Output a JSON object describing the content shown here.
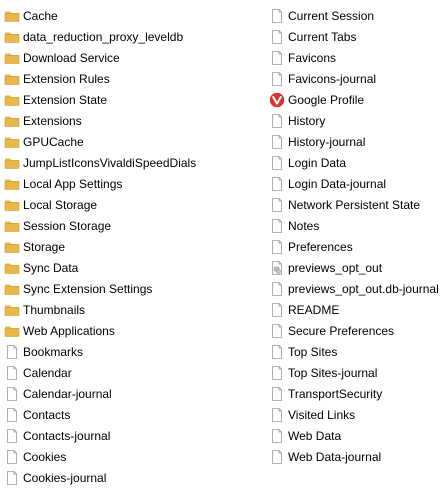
{
  "files": {
    "left": [
      {
        "name": "Cache",
        "icon": "folder-icon"
      },
      {
        "name": "data_reduction_proxy_leveldb",
        "icon": "folder-icon"
      },
      {
        "name": "Download Service",
        "icon": "folder-icon"
      },
      {
        "name": "Extension Rules",
        "icon": "folder-icon"
      },
      {
        "name": "Extension State",
        "icon": "folder-icon"
      },
      {
        "name": "Extensions",
        "icon": "folder-icon"
      },
      {
        "name": "GPUCache",
        "icon": "folder-icon"
      },
      {
        "name": "JumpListIconsVivaldiSpeedDials",
        "icon": "folder-icon"
      },
      {
        "name": "Local App Settings",
        "icon": "folder-icon"
      },
      {
        "name": "Local Storage",
        "icon": "folder-icon"
      },
      {
        "name": "Session Storage",
        "icon": "folder-icon"
      },
      {
        "name": "Storage",
        "icon": "folder-icon"
      },
      {
        "name": "Sync Data",
        "icon": "folder-icon"
      },
      {
        "name": "Sync Extension Settings",
        "icon": "folder-icon"
      },
      {
        "name": "Thumbnails",
        "icon": "folder-icon"
      },
      {
        "name": "Web Applications",
        "icon": "folder-icon"
      },
      {
        "name": "Bookmarks",
        "icon": "file-icon"
      },
      {
        "name": "Calendar",
        "icon": "file-icon"
      },
      {
        "name": "Calendar-journal",
        "icon": "file-icon"
      },
      {
        "name": "Contacts",
        "icon": "file-icon"
      },
      {
        "name": "Contacts-journal",
        "icon": "file-icon"
      },
      {
        "name": "Cookies",
        "icon": "file-icon"
      },
      {
        "name": "Cookies-journal",
        "icon": "file-icon"
      }
    ],
    "right": [
      {
        "name": "Current Session",
        "icon": "file-icon"
      },
      {
        "name": "Current Tabs",
        "icon": "file-icon"
      },
      {
        "name": "Favicons",
        "icon": "file-icon"
      },
      {
        "name": "Favicons-journal",
        "icon": "file-icon"
      },
      {
        "name": "Google Profile",
        "icon": "vivaldi-icon"
      },
      {
        "name": "History",
        "icon": "file-icon"
      },
      {
        "name": "History-journal",
        "icon": "file-icon"
      },
      {
        "name": "Login Data",
        "icon": "file-icon"
      },
      {
        "name": "Login Data-journal",
        "icon": "file-icon"
      },
      {
        "name": "Network Persistent State",
        "icon": "file-icon"
      },
      {
        "name": "Notes",
        "icon": "file-icon"
      },
      {
        "name": "Preferences",
        "icon": "file-icon"
      },
      {
        "name": "previews_opt_out",
        "icon": "db-file-icon"
      },
      {
        "name": "previews_opt_out.db-journal",
        "icon": "file-icon"
      },
      {
        "name": "README",
        "icon": "file-icon"
      },
      {
        "name": "Secure Preferences",
        "icon": "file-icon"
      },
      {
        "name": "Top Sites",
        "icon": "file-icon"
      },
      {
        "name": "Top Sites-journal",
        "icon": "file-icon"
      },
      {
        "name": "TransportSecurity",
        "icon": "file-icon"
      },
      {
        "name": "Visited Links",
        "icon": "file-icon"
      },
      {
        "name": "Web Data",
        "icon": "file-icon"
      },
      {
        "name": "Web Data-journal",
        "icon": "file-icon"
      }
    ]
  },
  "colors": {
    "folder": "#E8B84A",
    "folder_dark": "#C99A2E",
    "file_border": "#9A9A9A",
    "vivaldi": "#D7332F"
  }
}
